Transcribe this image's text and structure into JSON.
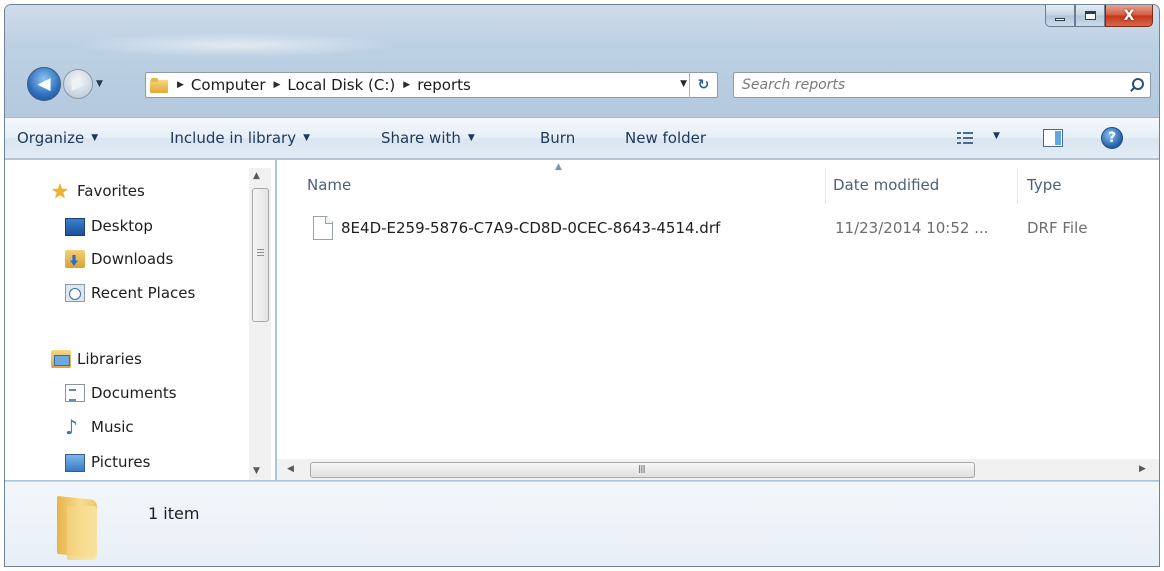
{
  "window": {
    "minimize_label": "minimize",
    "maximize_label": "maximize",
    "close_label": "X"
  },
  "address_bar": {
    "breadcrumbs": [
      "Computer",
      "Local Disk (C:)",
      "reports"
    ]
  },
  "search": {
    "placeholder": "Search reports"
  },
  "command_bar": {
    "organize": "Organize",
    "include_in_library": "Include in library",
    "share_with": "Share with",
    "burn": "Burn",
    "new_folder": "New folder",
    "help_glyph": "?"
  },
  "nav_pane": {
    "favorites": {
      "label": "Favorites",
      "icon": "star-icon",
      "items": [
        {
          "label": "Desktop",
          "icon": "desktop-icon"
        },
        {
          "label": "Downloads",
          "icon": "downloads-icon"
        },
        {
          "label": "Recent Places",
          "icon": "recent-places-icon"
        }
      ]
    },
    "libraries": {
      "label": "Libraries",
      "icon": "libraries-icon",
      "items": [
        {
          "label": "Documents",
          "icon": "documents-icon"
        },
        {
          "label": "Music",
          "icon": "music-icon"
        },
        {
          "label": "Pictures",
          "icon": "pictures-icon"
        }
      ]
    }
  },
  "file_list": {
    "columns": [
      "Name",
      "Date modified",
      "Type"
    ],
    "rows": [
      {
        "name": "8E4D-E259-5876-C7A9-CD8D-0CEC-8643-4514.drf",
        "date_modified": "11/23/2014 10:52 ...",
        "type": "DRF File",
        "icon": "generic-file-icon"
      }
    ],
    "h_scroll_grip": "III"
  },
  "details_pane": {
    "item_count": "1 item",
    "icon": "folder-icon"
  },
  "colors": {
    "accent": "#1e395b",
    "title_bar": "#b6cce0",
    "close_button": "#c4341a"
  }
}
